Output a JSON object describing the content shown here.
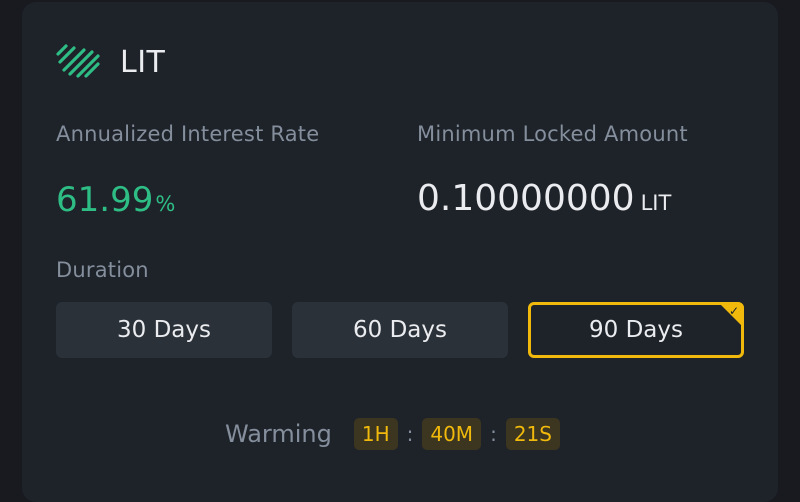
{
  "coin": {
    "name": "LIT",
    "icon": "litentry-logo-icon",
    "brand_color": "#2ebd85"
  },
  "rate": {
    "label": "Annualized Interest Rate",
    "value": "61.99",
    "unit": "%"
  },
  "min_locked": {
    "label": "Minimum Locked Amount",
    "value": "0.10000000",
    "unit": "LIT"
  },
  "duration": {
    "label": "Duration",
    "options": [
      "30 Days",
      "60 Days",
      "90 Days"
    ],
    "selected": "90 Days",
    "accent": "#f0b90b"
  },
  "warming": {
    "label": "Warming",
    "hours": "1H",
    "minutes": "40M",
    "seconds": "21S"
  }
}
